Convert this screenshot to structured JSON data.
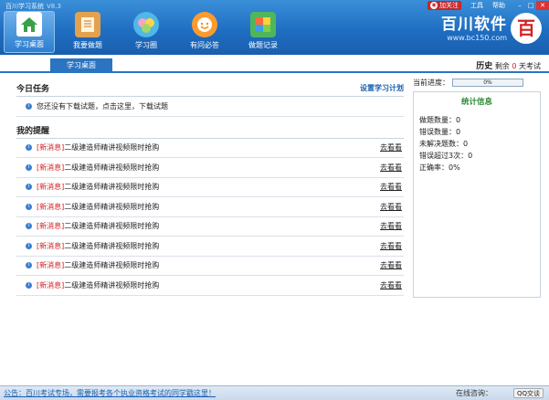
{
  "app": {
    "title": "百川学习系统",
    "version": "V8.3",
    "follow_label": "加关注",
    "menu_tools": "工具",
    "menu_help": "帮助",
    "brand_name": "百川软件",
    "brand_url": "www.bc150.com",
    "brand_logo_char": "百"
  },
  "nav": [
    {
      "label": "学习桌面",
      "icon": "home-icon",
      "active": true
    },
    {
      "label": "我要做题",
      "icon": "book-icon"
    },
    {
      "label": "学习圈",
      "icon": "circle-icon"
    },
    {
      "label": "有问必答",
      "icon": "qa-icon"
    },
    {
      "label": "做题记录",
      "icon": "record-icon"
    }
  ],
  "tab": {
    "label": "学习桌面"
  },
  "today": {
    "title": "今日任务",
    "plan_link": "设置学习计划",
    "task": "您还没有下载试题，点击这里，下载试题"
  },
  "reminders": {
    "title": "我的提醒",
    "tag": "[新消息]",
    "text": "二级建造师精讲视频限时抢购",
    "more": "去看看",
    "count": 8
  },
  "history": {
    "label": "历史",
    "remaining_prefix": "剩余",
    "days": "0",
    "suffix": "天考试",
    "progress_label": "当前进度：",
    "progress_value": "0%",
    "progress_percent": 0
  },
  "stats": {
    "title": "统计信息",
    "items": [
      "做题数量：0",
      "错误数量：0",
      "未解决题数：0",
      "错误超过3次：0",
      "正确率：0%"
    ]
  },
  "footer": {
    "notice": "公告：百川考试专场，需要报考各个执业资格考试的同学戳这里！",
    "consult": "在线咨询：",
    "qq": "QQ交谈"
  }
}
